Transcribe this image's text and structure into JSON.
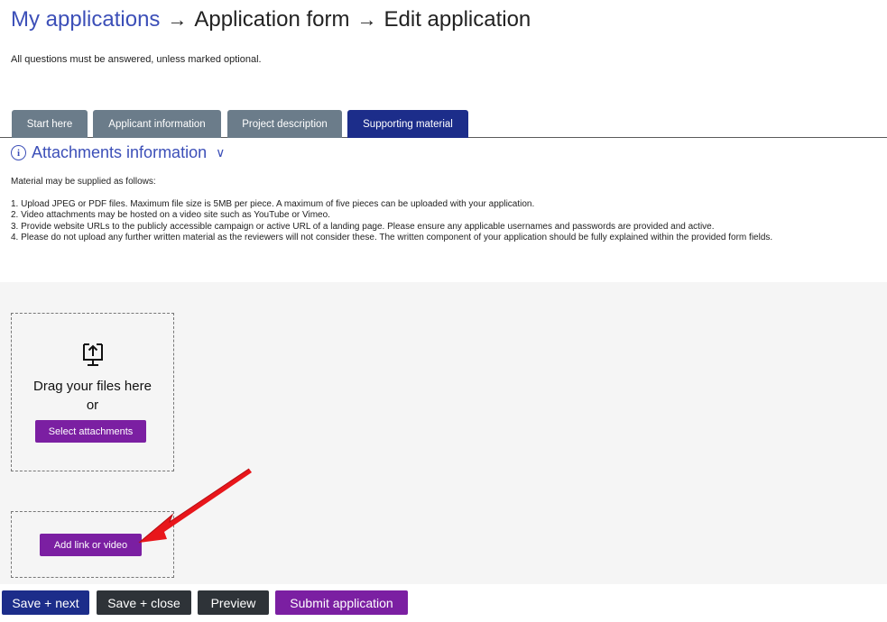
{
  "breadcrumb": {
    "my_applications": "My applications",
    "arrow": "→",
    "application_form": "Application form",
    "edit_application": "Edit application"
  },
  "intro": "All questions must be answered, unless marked optional.",
  "tabs": [
    {
      "label": "Start here"
    },
    {
      "label": "Applicant information"
    },
    {
      "label": "Project description"
    },
    {
      "label": "Supporting material"
    }
  ],
  "active_tab": "Supporting material",
  "attachments_info": {
    "icon_text": "i",
    "title": "Attachments information",
    "chevron": "∨"
  },
  "material": {
    "intro": "Material may be supplied as follows:",
    "items": [
      "1. Upload JPEG or PDF files. Maximum file size is 5MB per piece. A maximum of five pieces can be uploaded with your application.",
      "2. Video attachments may be hosted on a video site such as YouTube or Vimeo.",
      "3. Provide website URLs to the publicly accessible campaign or active URL of a landing page. Please ensure any applicable usernames and passwords are provided and active.",
      "4. Please do not upload any further written material as the reviewers will not consider these. The written component of your application should be fully explained within the provided form fields."
    ]
  },
  "upload": {
    "drag_text": "Drag your files here",
    "or_text": "or",
    "select_label": "Select attachments",
    "add_link_label": "Add link or video"
  },
  "actions": {
    "save_next": "Save + next",
    "save_close": "Save + close",
    "preview": "Preview",
    "submit": "Submit application"
  },
  "colors": {
    "link_blue": "#3c4fb8",
    "tab_active": "#1c2d8a",
    "tab_inactive": "#6b7c8a",
    "purple": "#7b1fa2",
    "dark_button": "#2e3338",
    "annotation_arrow": "#e8161b"
  },
  "icons": {
    "info": "info-circle-icon",
    "chevron": "chevron-down-icon",
    "upload": "upload-monitor-icon",
    "arrow": "red-annotation-arrow"
  }
}
